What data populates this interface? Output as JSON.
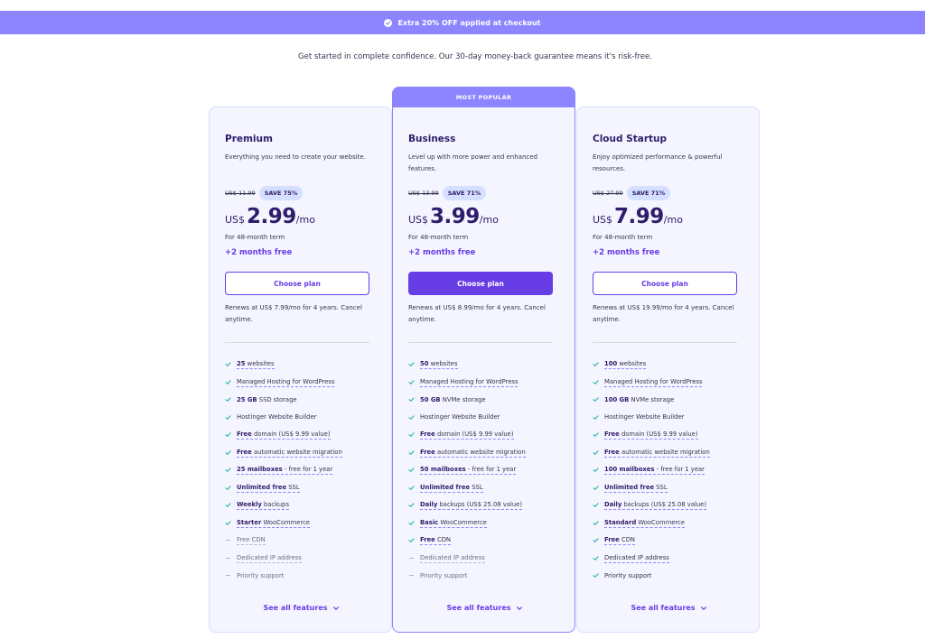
{
  "promo": {
    "text": "Extra 20% OFF applied at checkout"
  },
  "guarantee": "Get started in complete confidence. Our 30-day money-back guarantee means it's risk-free.",
  "popular_label": "MOST POPULAR",
  "see_all_label": "See all features",
  "colors": {
    "accent": "#673de6",
    "promo": "#8c85ff",
    "card_bg": "#f4f5ff",
    "check": "#00b090"
  },
  "plans": [
    {
      "name": "Premium",
      "desc": "Everything you need to create your website.",
      "old_price": "US$ 11.99",
      "save": "SAVE 75%",
      "currency": "US$",
      "price": "2.99",
      "per": "/mo",
      "term": "For 48-month term",
      "bonus": "+2 months free",
      "button": "Choose plan",
      "renew": "Renews at US$ 7.99/mo for 4 years. Cancel anytime.",
      "features": [
        {
          "icon": "check",
          "strong": "25",
          "text": " websites",
          "dashed": true
        },
        {
          "icon": "check",
          "strong": "",
          "text": "Managed Hosting for WordPress",
          "dashed": true
        },
        {
          "icon": "check",
          "strong": "25 GB",
          "text": " SSD storage",
          "dashed": false
        },
        {
          "icon": "check",
          "strong": "",
          "text": "Hostinger Website Builder",
          "dashed": false
        },
        {
          "icon": "check",
          "strong": "Free",
          "text": " domain (US$ 9.99 value)",
          "dashed": true
        },
        {
          "icon": "check",
          "strong": "Free",
          "text": " automatic website migration",
          "dashed": true
        },
        {
          "icon": "check",
          "strong": "25 mailboxes",
          "text": " - free for 1 year",
          "dashed": true
        },
        {
          "icon": "check",
          "strong": "Unlimited free",
          "text": " SSL",
          "dashed": true
        },
        {
          "icon": "check",
          "strong": "Weekly",
          "text": " backups",
          "dashed": true
        },
        {
          "icon": "check",
          "strong": "Starter",
          "text": " WooCommerce",
          "dashed": true
        },
        {
          "icon": "dash",
          "strong": "",
          "text": "Free CDN",
          "dashed": true
        },
        {
          "icon": "dash",
          "strong": "",
          "text": "Dedicated IP address",
          "dashed": true
        },
        {
          "icon": "dash",
          "strong": "",
          "text": "Priority support",
          "dashed": false
        }
      ]
    },
    {
      "name": "Business",
      "desc": "Level up with more power and enhanced features.",
      "old_price": "US$ 13.99",
      "save": "SAVE 71%",
      "currency": "US$",
      "price": "3.99",
      "per": "/mo",
      "term": "For 48-month term",
      "bonus": "+2 months free",
      "button": "Choose plan",
      "renew": "Renews at US$ 8.99/mo for 4 years. Cancel anytime.",
      "features": [
        {
          "icon": "check",
          "strong": "50",
          "text": " websites",
          "dashed": true
        },
        {
          "icon": "check",
          "strong": "",
          "text": "Managed Hosting for WordPress",
          "dashed": true
        },
        {
          "icon": "check",
          "strong": "50 GB",
          "text": " NVMe storage",
          "dashed": false
        },
        {
          "icon": "check",
          "strong": "",
          "text": "Hostinger Website Builder",
          "dashed": false
        },
        {
          "icon": "check",
          "strong": "Free",
          "text": " domain (US$ 9.99 value)",
          "dashed": true
        },
        {
          "icon": "check",
          "strong": "Free",
          "text": " automatic website migration",
          "dashed": true
        },
        {
          "icon": "check",
          "strong": "50 mailboxes",
          "text": " - free for 1 year",
          "dashed": true
        },
        {
          "icon": "check",
          "strong": "Unlimited free",
          "text": " SSL",
          "dashed": true
        },
        {
          "icon": "check",
          "strong": "Daily",
          "text": " backups (US$ 25.08 value)",
          "dashed": true
        },
        {
          "icon": "check",
          "strong": "Basic",
          "text": " WooCommerce",
          "dashed": true
        },
        {
          "icon": "check",
          "strong": "Free",
          "text": " CDN",
          "dashed": true
        },
        {
          "icon": "dash",
          "strong": "",
          "text": "Dedicated IP address",
          "dashed": true
        },
        {
          "icon": "dash",
          "strong": "",
          "text": "Priority support",
          "dashed": false
        }
      ]
    },
    {
      "name": "Cloud Startup",
      "desc": "Enjoy optimized performance & powerful resources.",
      "old_price": "US$ 27.99",
      "save": "SAVE 71%",
      "currency": "US$",
      "price": "7.99",
      "per": "/mo",
      "term": "For 48-month term",
      "bonus": "+2 months free",
      "button": "Choose plan",
      "renew": "Renews at US$ 19.99/mo for 4 years. Cancel anytime.",
      "features": [
        {
          "icon": "check",
          "strong": "100",
          "text": " websites",
          "dashed": true
        },
        {
          "icon": "check",
          "strong": "",
          "text": "Managed Hosting for WordPress",
          "dashed": true
        },
        {
          "icon": "check",
          "strong": "100 GB",
          "text": " NVMe storage",
          "dashed": false
        },
        {
          "icon": "check",
          "strong": "",
          "text": "Hostinger Website Builder",
          "dashed": false
        },
        {
          "icon": "check",
          "strong": "Free",
          "text": " domain (US$ 9.99 value)",
          "dashed": true
        },
        {
          "icon": "check",
          "strong": "Free",
          "text": " automatic website migration",
          "dashed": true
        },
        {
          "icon": "check",
          "strong": "100 mailboxes",
          "text": " - free for 1 year",
          "dashed": true
        },
        {
          "icon": "check",
          "strong": "Unlimited free",
          "text": " SSL",
          "dashed": true
        },
        {
          "icon": "check",
          "strong": "Daily",
          "text": " backups (US$ 25.08 value)",
          "dashed": true
        },
        {
          "icon": "check",
          "strong": "Standard",
          "text": " WooCommerce",
          "dashed": true
        },
        {
          "icon": "check",
          "strong": "Free",
          "text": " CDN",
          "dashed": true
        },
        {
          "icon": "check",
          "strong": "",
          "text": "Dedicated IP address",
          "dashed": true
        },
        {
          "icon": "check",
          "strong": "",
          "text": "Priority support",
          "dashed": false
        }
      ]
    }
  ]
}
